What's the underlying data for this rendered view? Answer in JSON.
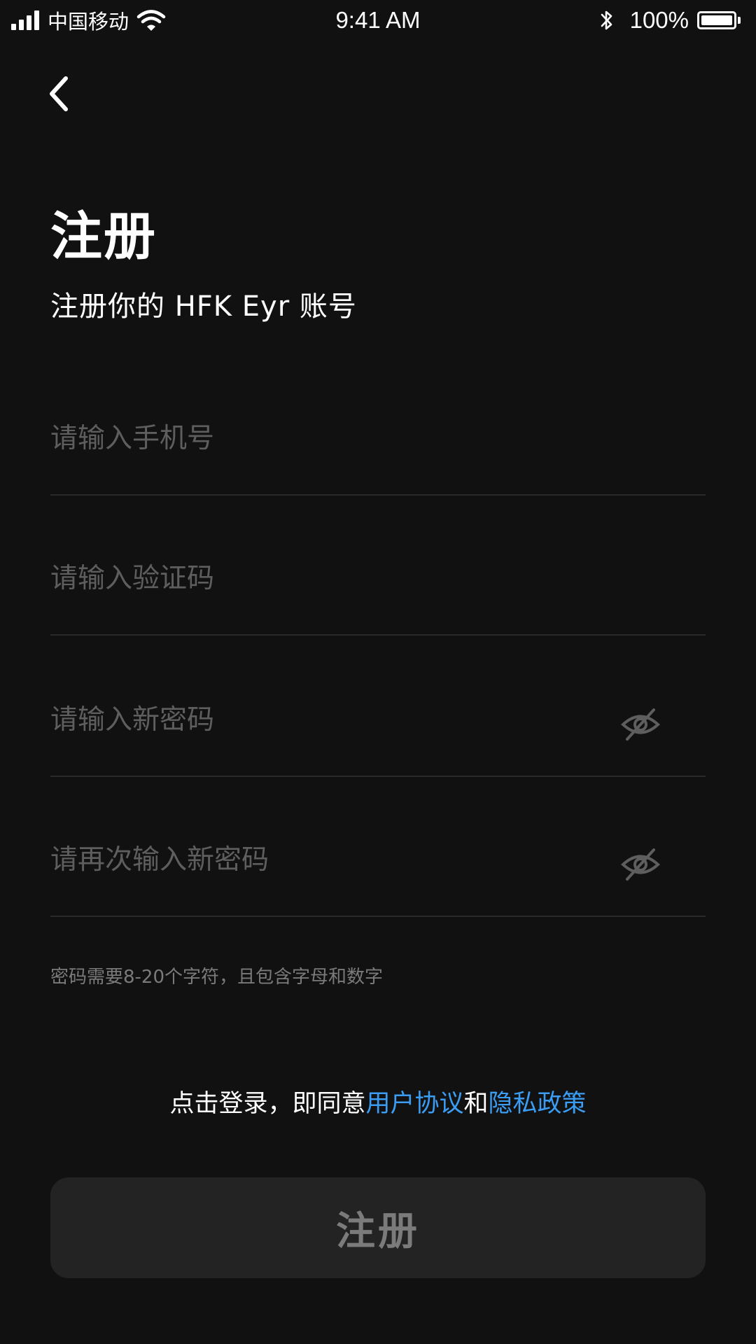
{
  "status_bar": {
    "carrier": "中国移动",
    "time": "9:41 AM",
    "battery": "100%"
  },
  "header": {
    "title": "注册",
    "subtitle": "注册你的 HFK Eyr 账号"
  },
  "form": {
    "phone_placeholder": "请输入手机号",
    "code_placeholder": "请输入验证码",
    "password_placeholder": "请输入新密码",
    "confirm_placeholder": "请再次输入新密码",
    "password_hint": "密码需要8-20个字符，且包含字母和数字"
  },
  "agreement": {
    "prefix": "点击登录，即同意",
    "terms_link": "用户协议",
    "conjunction": "和",
    "privacy_link": "隐私政策"
  },
  "actions": {
    "submit_label": "注册"
  },
  "colors": {
    "background": "#111111",
    "link": "#3a9cf2",
    "placeholder": "#5e5e5e",
    "button_bg": "#232323",
    "button_text": "#7b7b7b"
  },
  "icons": [
    "signal-icon",
    "wifi-icon",
    "bluetooth-icon",
    "battery-icon",
    "back-arrow-icon",
    "eye-off-icon"
  ]
}
